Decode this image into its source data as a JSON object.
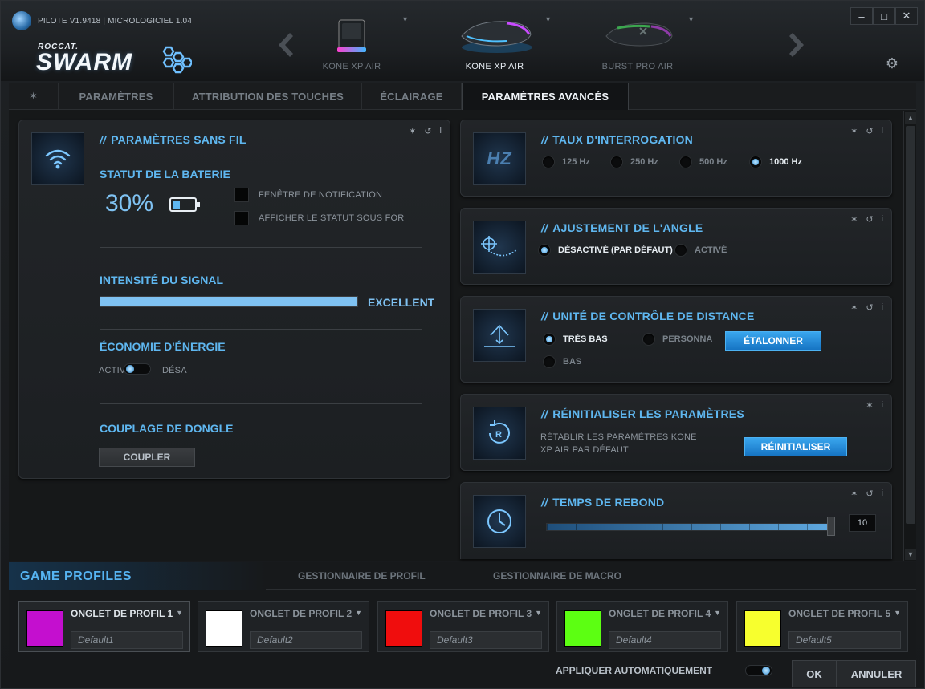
{
  "app": {
    "version": "PILOTE V1.9418 | MICROLOGICIEL 1.04",
    "brand": "ROCCAT.",
    "product": "SWARM"
  },
  "devices": [
    {
      "name": "KONE XP AIR",
      "selected": false
    },
    {
      "name": "KONE XP AIR",
      "selected": true
    },
    {
      "name": "BURST PRO AIR",
      "selected": false
    }
  ],
  "tabs": {
    "pin": "✶",
    "items": [
      "PARAMÈTRES",
      "ATTRIBUTION DES TOUCHES",
      "ÉCLAIRAGE",
      "PARAMÈTRES AVANCÉS"
    ],
    "active": "PARAMÈTRES AVANCÉS"
  },
  "wireless": {
    "title": "PARAMÈTRES SANS FIL",
    "battery_title": "STATUT DE LA BATERIE",
    "battery_value": "30%",
    "battery_level": 0.3,
    "checkbox_notification": "FENÊTRE DE NOTIFICATION",
    "checkbox_status": "AFFICHER LE STATUT SOUS FORM",
    "signal_title": "INTENSITÉ DU SIGNAL",
    "signal_value": "EXCELLENT",
    "signal_level": 1.0,
    "energy_title": "ÉCONOMIE D'ÉNERGIE",
    "energy_on": "ACTIV",
    "energy_off": "DÉSA",
    "dongle_title": "COUPLAGE DE DONGLE",
    "dongle_button": "COUPLER"
  },
  "polling": {
    "title": "TAUX D'INTERROGATION",
    "options": [
      "125 Hz",
      "250 Hz",
      "500 Hz",
      "1000 Hz"
    ],
    "selected": "1000 Hz",
    "icon_text": "HZ"
  },
  "angle": {
    "title": "AJUSTEMENT DE L'ANGLE",
    "options": [
      "DÉSACTIVÉ (PAR DÉFAUT)",
      "ACTIVÉ"
    ],
    "selected": "DÉSACTIVÉ (PAR DÉFAUT)"
  },
  "distance": {
    "title": "UNITÉ DE CONTRÔLE DE DISTANCE",
    "options": [
      "TRÈS BAS",
      "BAS",
      "PERSONNA"
    ],
    "selected": "TRÈS BAS",
    "button": "ÉTALONNER"
  },
  "reset": {
    "title": "RÉINITIALISER LES PARAMÈTRES",
    "line1": "RÉTABLIR LES PARAMÈTRES KONE",
    "line2": "XP AIR PAR DÉFAUT",
    "button": "RÉINITIALISER"
  },
  "debounce": {
    "title": "TEMPS DE REBOND",
    "value": "10",
    "level": 1.0
  },
  "bottom": {
    "game_profiles": "GAME PROFILES",
    "tab_profile_manager": "GESTIONNAIRE DE PROFIL",
    "tab_macro_manager": "GESTIONNAIRE DE MACRO",
    "profiles": [
      {
        "name": "ONGLET DE PROFIL 1",
        "value": "Default1",
        "color": "#c40fcf",
        "selected": true
      },
      {
        "name": "ONGLET DE PROFIL 2",
        "value": "Default2",
        "color": "#ffffff",
        "selected": false
      },
      {
        "name": "ONGLET DE PROFIL 3",
        "value": "Default3",
        "color": "#f00d0d",
        "selected": false
      },
      {
        "name": "ONGLET DE PROFIL 4",
        "value": "Default4",
        "color": "#5cff12",
        "selected": false
      },
      {
        "name": "ONGLET DE PROFIL 5",
        "value": "Default5",
        "color": "#f7ff2e",
        "selected": false
      }
    ],
    "auto_apply": "APPLIQUER AUTOMATIQUEMENT",
    "ok": "OK",
    "cancel": "ANNULER"
  },
  "colors": {
    "accent": "#5fb7f0",
    "button_blue": "#2a8fdc",
    "signal_bar": "#7fc2f2"
  }
}
